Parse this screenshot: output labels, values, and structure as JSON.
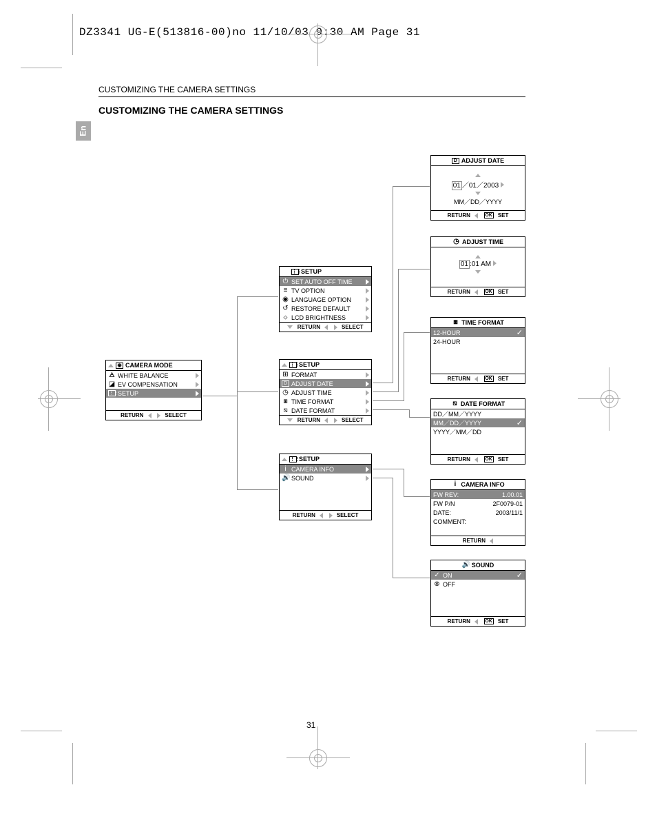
{
  "slug": "DZ3341 UG-E(513816-00)no  11/10/03  9:30 AM  Page 31",
  "section_header": "CUSTOMIZING THE CAMERA SETTINGS",
  "title": "CUSTOMIZING THE CAMERA SETTINGS",
  "lang_tab": "En",
  "page_number": "31",
  "labels": {
    "return": "RETURN",
    "select": "SELECT",
    "set": "SET",
    "ok": "OK",
    "setup": "SETUP"
  },
  "camera_mode": {
    "title": "CAMERA MODE",
    "items": [
      "WHITE BALANCE",
      "EV COMPENSATION",
      "SETUP"
    ]
  },
  "setup1": {
    "items": [
      "SET AUTO OFF TIME",
      "TV OPTION",
      "LANGUAGE OPTION",
      "RESTORE DEFAULT",
      "LCD BRIGHTNESS"
    ]
  },
  "setup2": {
    "items": [
      "FORMAT",
      "ADJUST DATE",
      "ADJUST TIME",
      "TIME FORMAT",
      "DATE FORMAT"
    ]
  },
  "setup3": {
    "items": [
      "CAMERA INFO",
      "SOUND"
    ]
  },
  "adjust_date": {
    "title": "ADJUST  DATE",
    "value": "01／01／2003",
    "format": "MM／DD／YYYY"
  },
  "adjust_time": {
    "title": "ADJUST  TIME",
    "value": ":01 AM",
    "seg": "01"
  },
  "time_format": {
    "title": "TIME  FORMAT",
    "options": [
      "12-HOUR",
      "24-HOUR"
    ]
  },
  "date_format": {
    "title": "DATE  FORMAT",
    "options": [
      "DD／MM／YYYY",
      "MM／DD／YYYY",
      "YYYY／MM／DD"
    ]
  },
  "camera_info": {
    "title": "CAMERA  INFO",
    "rows": [
      {
        "k": "FW REV:",
        "v": "1.00.01"
      },
      {
        "k": "FW  P/N",
        "v": "2F0079-01"
      },
      {
        "k": "DATE:",
        "v": "2003/11/1"
      },
      {
        "k": "COMMENT:",
        "v": ""
      }
    ]
  },
  "sound": {
    "title": "SOUND",
    "options": [
      "ON",
      "OFF"
    ]
  }
}
